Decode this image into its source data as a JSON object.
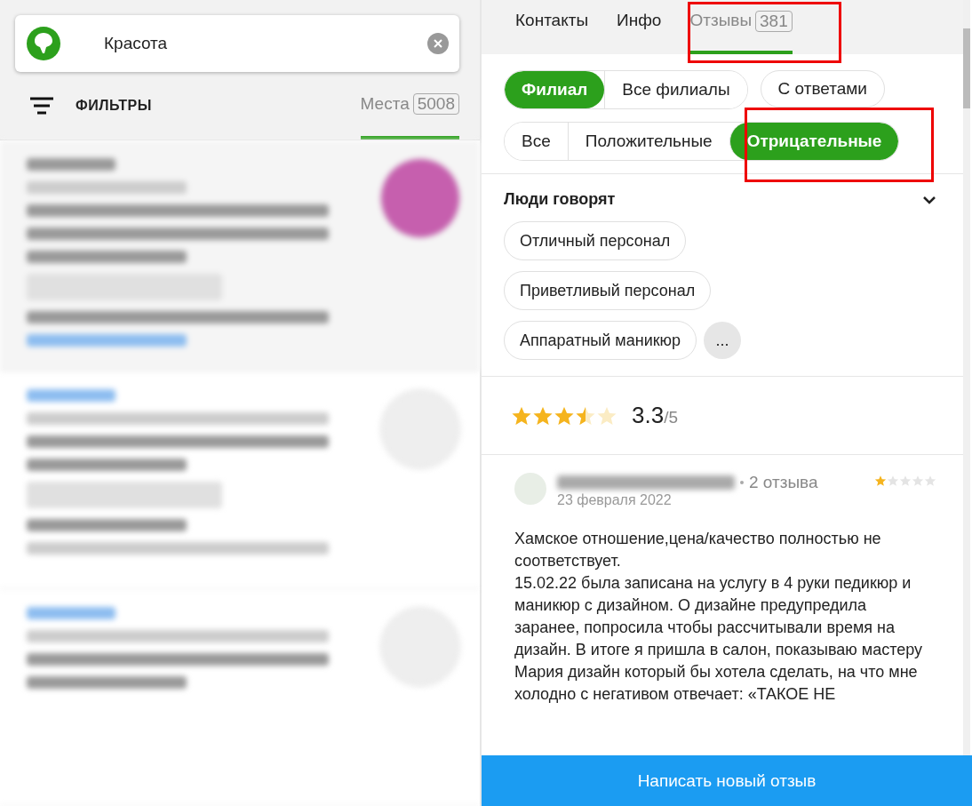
{
  "search": {
    "value": "Красота"
  },
  "filters": {
    "label": "ФИЛЬТРЫ"
  },
  "left_tabs": [
    {
      "label": "Места",
      "count": "5008",
      "selected": true
    }
  ],
  "tabs": [
    {
      "label": "Контакты",
      "selected": false
    },
    {
      "label": "Инфо",
      "selected": false
    },
    {
      "label": "Отзывы",
      "count": "381",
      "selected": true
    }
  ],
  "branch_filter": [
    {
      "label": "Филиал",
      "selected": true
    },
    {
      "label": "Все филиалы",
      "selected": false
    }
  ],
  "answers_filter": {
    "label": "С ответами",
    "selected": false
  },
  "tone_filter": [
    {
      "label": "Все",
      "selected": false
    },
    {
      "label": "Положительные",
      "selected": false
    },
    {
      "label": "Отрицательные",
      "selected": true
    }
  ],
  "people_say": {
    "title": "Люди говорят",
    "expanded": true,
    "tags": [
      "Отличный персонал",
      "Приветливый персонал",
      "Аппаратный маникюр"
    ],
    "more": "..."
  },
  "rating": {
    "stars": 3.5,
    "value": "3.3",
    "max": "/5"
  },
  "review": {
    "count": "2 отзыва",
    "date": "23 февраля 2022",
    "stars": 1,
    "paragraphs": [
      "Хамское отношение,цена/качество полностью не соответствует.",
      "15.02.22 была записана на услугу в 4 руки педикюр и маникюр с дизайном. О дизайне предупредила заранее, попросила чтобы рассчитывали время на дизайн. В итоге я пришла в салон, показываю мастеру Мария дизайн который бы хотела сделать, на что мне холодно с негативом отвечает: «ТАКОЕ НЕ"
    ]
  },
  "write_button": "Написать новый отзыв"
}
